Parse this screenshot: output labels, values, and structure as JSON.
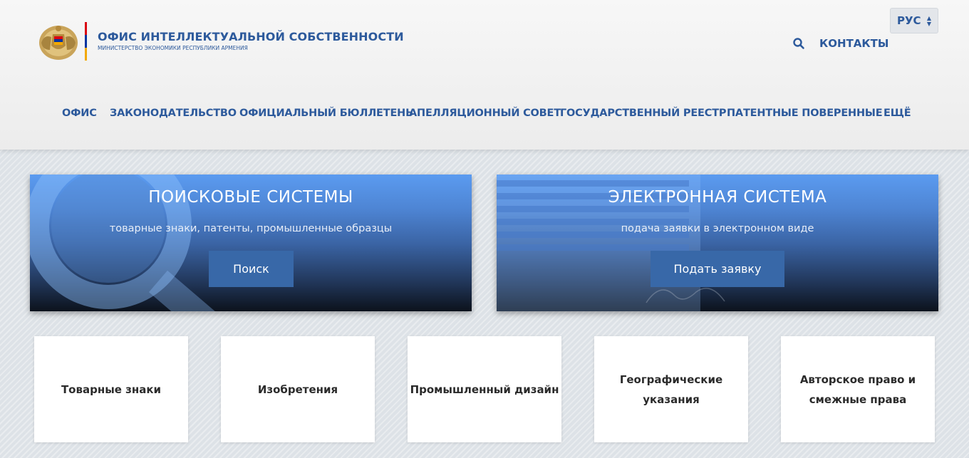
{
  "header": {
    "title": "ОФИС ИНТЕЛЛЕКТУАЛЬНОЙ СОБСТВЕННОСТИ",
    "subtitle": "МИНИСТЕРСТВО ЭКОНОМИКИ РЕСПУБЛИКИ АРМЕНИЯ",
    "language": "РУС",
    "contacts_label": "КОНТАКТЫ",
    "flag_colors": [
      "#d90012",
      "#0033a0",
      "#f2a800"
    ]
  },
  "nav": {
    "items": [
      {
        "label": "ОФИС"
      },
      {
        "label": "ЗАКОНОДАТЕЛЬСТВО"
      },
      {
        "label": "ОФИЦИАЛЬНЫЙ БЮЛЛЕТЕНЬ"
      },
      {
        "label": "АПЕЛЛЯЦИОННЫЙ СОВЕТ"
      },
      {
        "label": "ГОСУДАРСТВЕННЫЙ РЕЕСТР"
      },
      {
        "label": "ПАТЕНТНЫЕ ПОВЕРЕННЫЕ"
      },
      {
        "label": "ЕЩЁ"
      }
    ]
  },
  "promos": {
    "search": {
      "title": "ПОИСКОВЫЕ СИСТЕМЫ",
      "subtitle": "товарные знаки, патенты, промышленные образцы",
      "button": "Поиск"
    },
    "esystem": {
      "title": "ЭЛЕКТРОННАЯ СИСТЕМА",
      "subtitle": "подача заявки в электронном виде",
      "button": "Подать заявку"
    }
  },
  "categories": [
    {
      "label": "Товарные знаки"
    },
    {
      "label": "Изобретения"
    },
    {
      "label": "Промышленный дизайн"
    },
    {
      "label": "Географические указания"
    },
    {
      "label": "Авторское право и\nсмежные права"
    }
  ],
  "colors": {
    "brand_blue": "#2d5a9c",
    "button_blue": "#3868a8"
  }
}
